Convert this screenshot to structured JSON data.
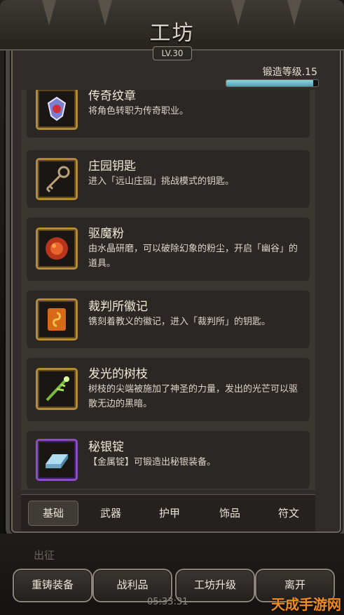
{
  "header": {
    "title": "工坊",
    "level": "LV.30",
    "forge_label": "锻造等级.15",
    "forge_progress": 0.95
  },
  "items": [
    {
      "name": "传奇纹章",
      "desc": "将角色转职为传奇职业。",
      "icon": "legend-crest-icon"
    },
    {
      "name": "庄园钥匙",
      "desc": "进入「远山庄园」挑战模式的钥匙。",
      "icon": "key-icon"
    },
    {
      "name": "驱魔粉",
      "desc": "由水晶研磨，可以破除幻象的粉尘，开启「幽谷」的道具。",
      "icon": "powder-icon"
    },
    {
      "name": "裁判所徽记",
      "desc": "镌刻着教义的徽记，进入「裁判所」的钥匙。",
      "icon": "emblem-icon"
    },
    {
      "name": "发光的树枝",
      "desc": "树枝的尖端被施加了神圣的力量，发出的光芒可以驱散无边的黑暗。",
      "icon": "branch-icon"
    },
    {
      "name": "秘银锭",
      "desc": "【金属锭】可锻造出秘银装备。",
      "icon": "ingot-icon"
    }
  ],
  "tabs": [
    {
      "label": "基础",
      "active": true
    },
    {
      "label": "武器"
    },
    {
      "label": "护甲"
    },
    {
      "label": "饰品"
    },
    {
      "label": "符文"
    }
  ],
  "bottom": {
    "faded_label": "出征",
    "buttons": [
      "重铸装备",
      "战利品",
      "工坊升级",
      "离开"
    ],
    "clock": "05:33:31"
  },
  "watermark": "天成手游网"
}
